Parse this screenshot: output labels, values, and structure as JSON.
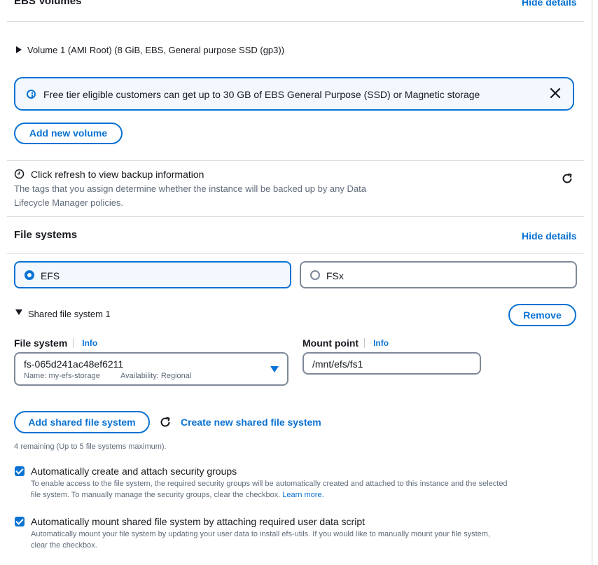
{
  "ebs": {
    "title": "EBS Volumes",
    "hide_details": "Hide details",
    "volume_label": "Volume 1 (AMI Root) (8 GiB, EBS, General purpose SSD (gp3))",
    "alert_text": "Free tier eligible customers can get up to 30 GB of EBS General Purpose (SSD) or Magnetic storage",
    "add_volume": "Add new volume",
    "backup_title": "Click refresh to view backup information",
    "backup_desc_1": "The tags that you assign determine whether the instance will be backed up by any Data",
    "backup_desc_2": "Lifecycle Manager policies."
  },
  "file_systems": {
    "title": "File systems",
    "hide_details": "Hide details",
    "options": [
      {
        "label": "EFS",
        "selected": true
      },
      {
        "label": "FSx",
        "selected": false
      }
    ],
    "shared_title": "Shared file system 1",
    "remove": "Remove",
    "fs_label": "File system",
    "info": "Info",
    "fs_value": "fs-065d241ac48ef6211",
    "fs_name": "Name: my-efs-storage",
    "fs_availability": "Availability: Regional",
    "mount_label": "Mount point",
    "mount_value": "/mnt/efs/fs1",
    "add_shared": "Add shared file system",
    "create_new": "Create new shared file system",
    "remaining": "4 remaining (Up to 5 file systems maximum).",
    "auto_sg_label": "Automatically create and attach security groups",
    "auto_sg_desc_1": "To enable access to the file system, the required security groups will be automatically created and attached to this instance and the selected",
    "auto_sg_desc_2": "file system. To manually manage the security groups, clear the checkbox.",
    "learn_more": "Learn more.",
    "auto_mount_label": "Automatically mount shared file system by attaching required user data script",
    "auto_mount_desc_1": "Automatically mount your file system by updating your user data to install efs-utils. If you would like to manually mount your file system,",
    "auto_mount_desc_2": "clear the checkbox."
  },
  "colors": {
    "accent": "#0972d3",
    "selected_bg": "#f2f8fd",
    "border": "#7d8998"
  }
}
